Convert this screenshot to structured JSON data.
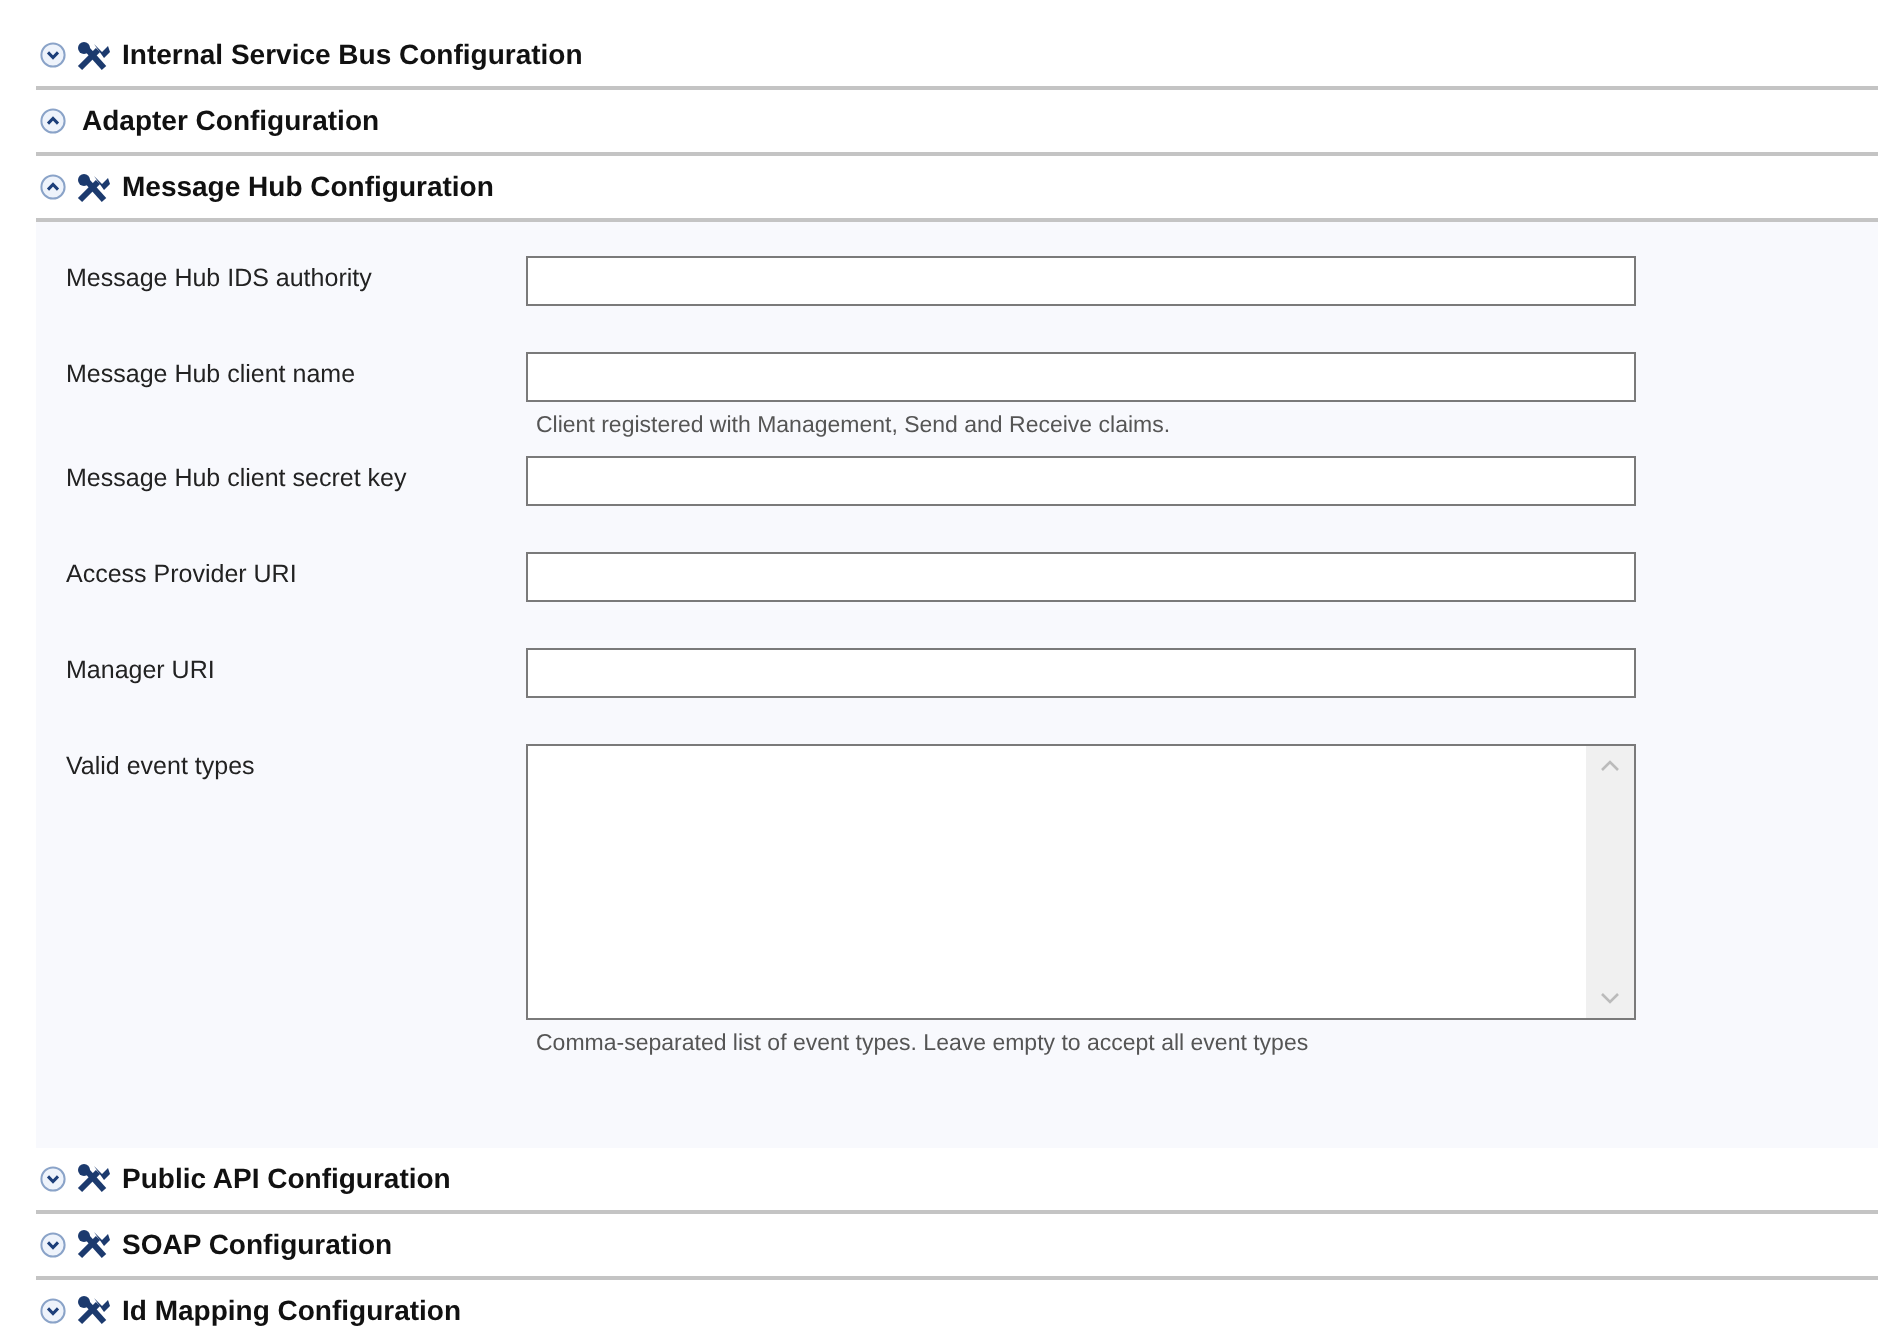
{
  "sections": [
    {
      "title": "Internal Service Bus Configuration",
      "kind": "tools",
      "expanded": false
    },
    {
      "title": "Adapter Configuration",
      "kind": "plain",
      "expanded": true
    },
    {
      "title": "Message Hub Configuration",
      "kind": "tools",
      "expanded": true,
      "fields": [
        {
          "label": "Message Hub IDS authority",
          "kind": "text"
        },
        {
          "label": "Message Hub client name",
          "kind": "text",
          "hint": "Client registered with Management, Send and Receive claims."
        },
        {
          "label": "Message Hub client secret key",
          "kind": "text"
        },
        {
          "label": "Access Provider URI",
          "kind": "text"
        },
        {
          "label": "Manager URI",
          "kind": "text"
        },
        {
          "label": "Valid event types",
          "kind": "multiline",
          "hint": "Comma-separated list of event types. Leave empty to accept all event types"
        }
      ]
    },
    {
      "title": "Public API Configuration",
      "kind": "tools",
      "expanded": false
    },
    {
      "title": "SOAP Configuration",
      "kind": "tools",
      "expanded": false
    },
    {
      "title": "Id Mapping Configuration",
      "kind": "tools",
      "expanded": false
    }
  ]
}
